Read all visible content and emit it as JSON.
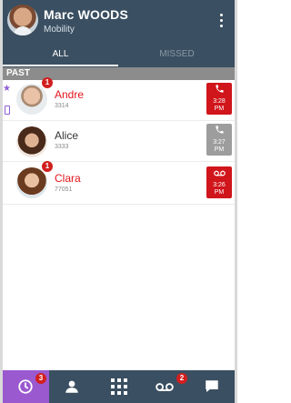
{
  "header": {
    "user_name": "Marc WOODS",
    "status": "Mobility"
  },
  "tabs": [
    {
      "label": "ALL",
      "selected": true
    },
    {
      "label": "MISSED",
      "selected": false
    }
  ],
  "section_label": "PAST",
  "calls": [
    {
      "name": "Andre",
      "extension": "3314",
      "missed": true,
      "badge": "1",
      "favorite": true,
      "time_lines": [
        "3:28",
        "PM"
      ],
      "tile_color": "#d0151b",
      "tile_icon": "phone-icon"
    },
    {
      "name": "Alice",
      "extension": "3333",
      "missed": false,
      "badge": "",
      "favorite": false,
      "time_lines": [
        "3:27",
        "PM"
      ],
      "tile_color": "#9d9d9d",
      "tile_icon": "phone-icon"
    },
    {
      "name": "Clara",
      "extension": "77051",
      "missed": true,
      "badge": "1",
      "favorite": false,
      "time_lines": [
        "3:26",
        "PM"
      ],
      "tile_color": "#d0151b",
      "tile_icon": "voicemail-icon"
    }
  ],
  "bottom_nav": [
    {
      "icon": "clock-icon",
      "badge": "3",
      "active": true
    },
    {
      "icon": "contacts-icon",
      "badge": "",
      "active": false
    },
    {
      "icon": "dialpad-icon",
      "badge": "",
      "active": false
    },
    {
      "icon": "voicemail-icon",
      "badge": "2",
      "active": false
    },
    {
      "icon": "chat-icon",
      "badge": "",
      "active": false
    }
  ],
  "colors": {
    "header_bg": "#3a4f61",
    "missed_red": "#e3141b",
    "active_purple": "#9b59d0"
  }
}
